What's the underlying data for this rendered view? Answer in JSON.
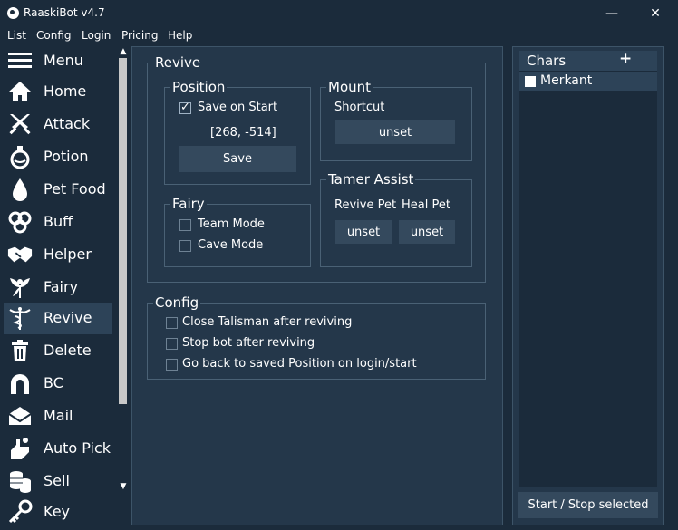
{
  "app": {
    "title": "RaaskiBot v4.7"
  },
  "window": {
    "minimize": "—",
    "close": "✕"
  },
  "menubar": [
    "List",
    "Config",
    "Login",
    "Pricing",
    "Help"
  ],
  "sidebar": {
    "items": [
      {
        "label": "Menu",
        "icon": "hamburger-icon"
      },
      {
        "label": "Home",
        "icon": "home-icon"
      },
      {
        "label": "Attack",
        "icon": "swords-icon"
      },
      {
        "label": "Potion",
        "icon": "potion-icon"
      },
      {
        "label": "Pet Food",
        "icon": "drop-icon"
      },
      {
        "label": "Buff",
        "icon": "spiral-icon"
      },
      {
        "label": "Helper",
        "icon": "handshake-icon"
      },
      {
        "label": "Fairy",
        "icon": "fairy-icon"
      },
      {
        "label": "Revive",
        "icon": "caduceus-icon"
      },
      {
        "label": "Delete",
        "icon": "trash-icon"
      },
      {
        "label": "BC",
        "icon": "horseshoe-icon"
      },
      {
        "label": "Mail",
        "icon": "mail-icon"
      },
      {
        "label": "Auto Pick",
        "icon": "hand-pick-icon"
      },
      {
        "label": "Sell",
        "icon": "coins-icon"
      },
      {
        "label": "Key",
        "icon": "key-icon"
      }
    ],
    "active": "Revive"
  },
  "revive": {
    "title": "Revive",
    "position": {
      "title": "Position",
      "save_on_start_label": "Save on Start",
      "save_on_start": true,
      "coords": "[268, -514]",
      "save_button": "Save"
    },
    "mount": {
      "title": "Mount",
      "shortcut_label": "Shortcut",
      "shortcut_value": "unset"
    },
    "fairy": {
      "title": "Fairy",
      "team_mode_label": "Team Mode",
      "cave_mode_label": "Cave Mode"
    },
    "tamer": {
      "title": "Tamer Assist",
      "revive_pet_label": "Revive Pet",
      "revive_pet_value": "unset",
      "heal_pet_label": "Heal Pet",
      "heal_pet_value": "unset"
    }
  },
  "config": {
    "title": "Config",
    "options": [
      "Close Talisman after reviving",
      "Stop bot after reviving",
      "Go back to saved Position on login/start"
    ]
  },
  "chars": {
    "title": "Chars",
    "add": "+",
    "list": [
      "Merkant"
    ],
    "start_stop_button": "Start / Stop selected"
  },
  "colors": {
    "background": "#1b2b3b",
    "panel": "#24374a",
    "button": "#34495d",
    "active": "#2d4358"
  }
}
